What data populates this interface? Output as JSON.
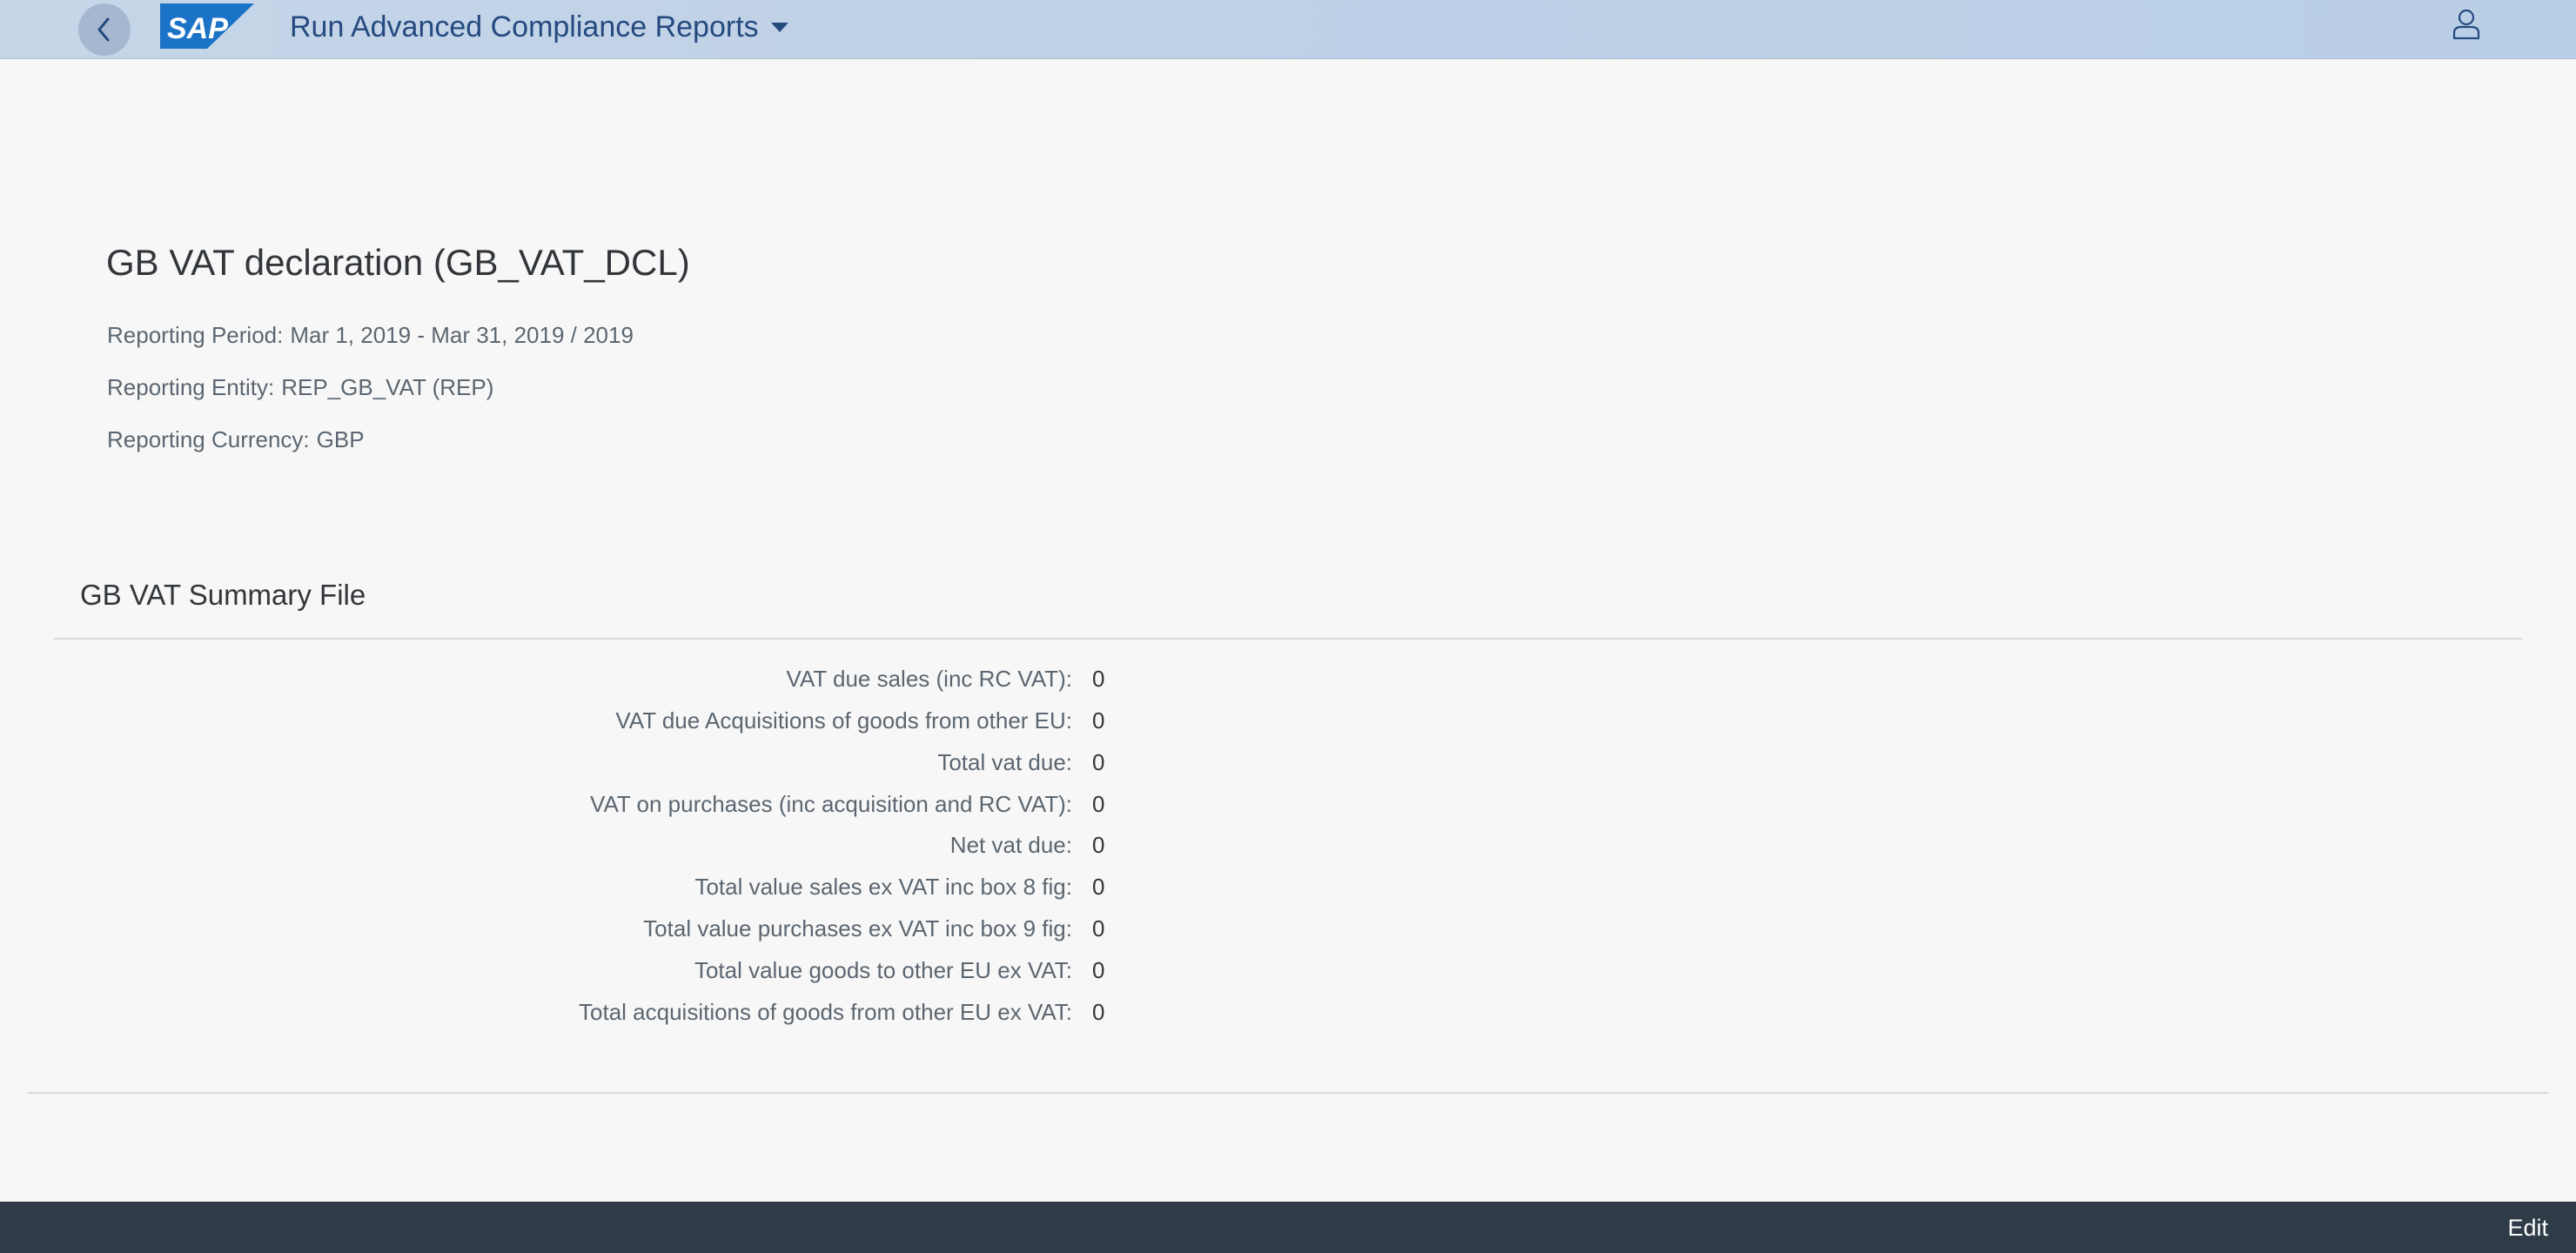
{
  "shell": {
    "app_title": "Run Advanced Compliance Reports",
    "logo_text": "SAP",
    "brand_color": "#1a73c6",
    "back_icon": "back-icon",
    "user_icon": "user-icon"
  },
  "report": {
    "title": "GB VAT declaration (GB_VAT_DCL)",
    "period_label": "Reporting Period:",
    "period_value": "Mar 1, 2019 - Mar 31, 2019 / 2019",
    "entity_label": "Reporting Entity:",
    "entity_value": "REP_GB_VAT (REP)",
    "currency_label": "Reporting Currency:",
    "currency_value": "GBP"
  },
  "summary": {
    "title": "GB VAT Summary File",
    "rows": [
      {
        "label": "VAT due sales (inc RC VAT):",
        "value": "0"
      },
      {
        "label": "VAT due Acquisitions of goods from other EU:",
        "value": "0"
      },
      {
        "label": "Total vat due:",
        "value": "0"
      },
      {
        "label": "VAT on purchases (inc acquisition and RC VAT):",
        "value": "0"
      },
      {
        "label": "Net vat due:",
        "value": "0"
      },
      {
        "label": "Total value sales ex VAT inc box 8 fig:",
        "value": "0"
      },
      {
        "label": "Total value purchases ex VAT inc box 9 fig:",
        "value": "0"
      },
      {
        "label": "Total value goods to other EU ex VAT:",
        "value": "0"
      },
      {
        "label": "Total acquisitions of goods from other EU ex VAT:",
        "value": "0"
      }
    ]
  },
  "footer": {
    "edit_label": "Edit"
  }
}
